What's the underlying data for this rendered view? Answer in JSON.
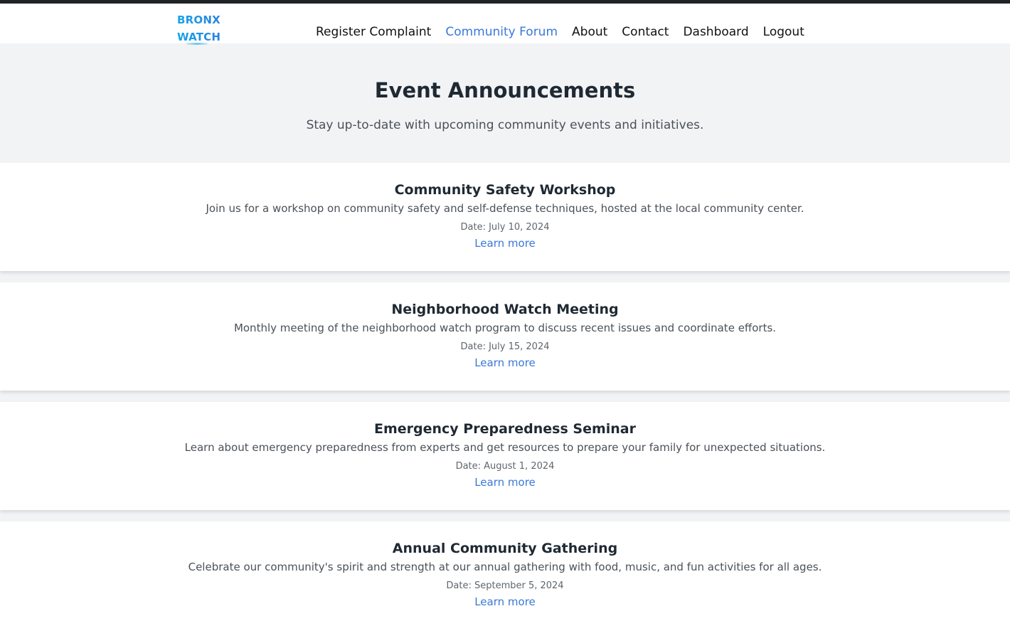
{
  "brand": {
    "line1": "BRONX",
    "line2": "WATCH"
  },
  "nav": {
    "items": [
      {
        "label": "Register Complaint",
        "active": false
      },
      {
        "label": "Community Forum",
        "active": true
      },
      {
        "label": "About",
        "active": false
      },
      {
        "label": "Contact",
        "active": false
      },
      {
        "label": "Dashboard",
        "active": false
      },
      {
        "label": "Logout",
        "active": false
      }
    ]
  },
  "hero": {
    "title": "Event Announcements",
    "subtitle": "Stay up-to-date with upcoming community events and initiatives."
  },
  "events": [
    {
      "title": "Community Safety Workshop",
      "description": "Join us for a workshop on community safety and self-defense techniques, hosted at the local community center.",
      "date": "Date: July 10, 2024",
      "link": "Learn more"
    },
    {
      "title": "Neighborhood Watch Meeting",
      "description": "Monthly meeting of the neighborhood watch program to discuss recent issues and coordinate efforts.",
      "date": "Date: July 15, 2024",
      "link": "Learn more"
    },
    {
      "title": "Emergency Preparedness Seminar",
      "description": "Learn about emergency preparedness from experts and get resources to prepare your family for unexpected situations.",
      "date": "Date: August 1, 2024",
      "link": "Learn more"
    },
    {
      "title": "Annual Community Gathering",
      "description": "Celebrate our community's spirit and strength at our annual gathering with food, music, and fun activities for all ages.",
      "date": "Date: September 5, 2024",
      "link": "Learn more"
    }
  ],
  "colors": {
    "accent": "#3a78d8",
    "brand_start": "#14a4e8",
    "brand_end": "#2a7fe0",
    "hero_bg": "#f2f3f5",
    "top_bar": "#1f2326"
  }
}
